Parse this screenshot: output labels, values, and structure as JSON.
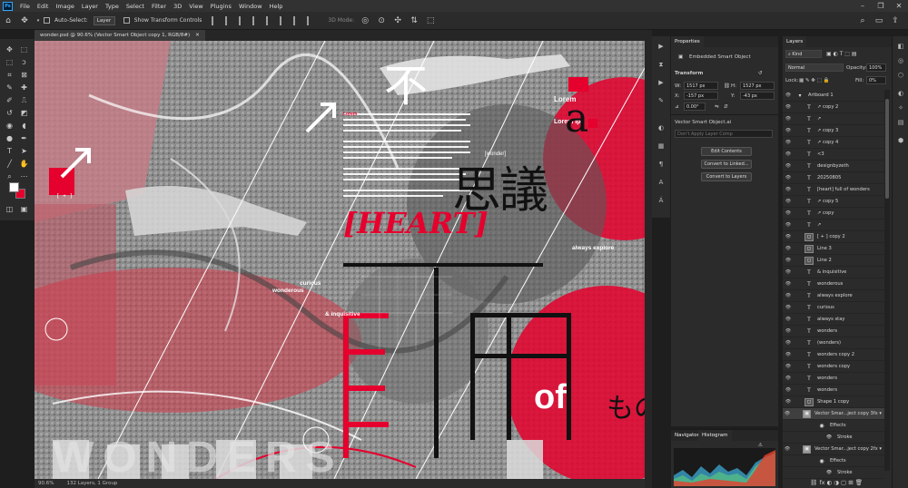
{
  "menu": [
    "File",
    "Edit",
    "Image",
    "Layer",
    "Type",
    "Select",
    "Filter",
    "3D",
    "View",
    "Plugins",
    "Window",
    "Help"
  ],
  "options": {
    "auto_select": "Auto-Select:",
    "layer_select": "Layer",
    "show_transform": "Show Transform Controls",
    "mode_3d": "3D Mode:"
  },
  "document": {
    "tab_title": "wonder.psd @ 90.6% (Vector Smart Object copy 1, RGB/8#)",
    "zoom": "90.6%",
    "layer_count": "132 Layers, 1 Group"
  },
  "canvas_text": {
    "lorem1": "Lorem",
    "lorem2": "Lorem Ip",
    "lorem3": "Lorem",
    "letter_a": "a",
    "kanji1": "思議",
    "heart": "[HEART]",
    "wonder_tag": "[wonder]",
    "always_explore": "always explore",
    "curious": "curious",
    "wonderous": "wonderous",
    "inquisitive": "& inquisitive",
    "of": "of",
    "kanji_bottom": "もの",
    "kanji_top": "不",
    "bottom_word": "WONDERS",
    "canvas_bracket": "[ + ]"
  },
  "properties": {
    "tab": "Properties",
    "kind": "Embedded Smart Object",
    "section": "Transform",
    "w_label": "W:",
    "w": "1517 px",
    "h_label": "H:",
    "h": "1527 px",
    "x_label": "X:",
    "x": "-157 px",
    "y_label": "Y:",
    "y": "-43 px",
    "angle": "0.00°",
    "file": "Vector Smart Object.ai",
    "comp": "Don't Apply Layer Comp",
    "btn_edit": "Edit Contents",
    "btn_linked": "Convert to Linked...",
    "btn_layers": "Convert to Layers"
  },
  "bottom_tabs": {
    "navigator": "Navigator",
    "histogram": "Histogram"
  },
  "layers_panel": {
    "tab": "Layers",
    "kind": "Kind",
    "blend": "Normal",
    "opacity_label": "Opacity:",
    "opacity": "100%",
    "lock_label": "Lock:",
    "fill_label": "Fill:",
    "fill": "0%",
    "rows": [
      {
        "type": "group",
        "name": "Artboard 1"
      },
      {
        "type": "T",
        "name": "↗ copy 2"
      },
      {
        "type": "T",
        "name": "↗"
      },
      {
        "type": "T",
        "name": "↗ copy 3"
      },
      {
        "type": "T",
        "name": "↗ copy 4"
      },
      {
        "type": "T",
        "name": "<3"
      },
      {
        "type": "T",
        "name": "designbyzeth"
      },
      {
        "type": "T",
        "name": "20250805"
      },
      {
        "type": "T",
        "name": "[heart] full of wonders"
      },
      {
        "type": "T",
        "name": "↗ copy 5"
      },
      {
        "type": "T",
        "name": "↗ copy"
      },
      {
        "type": "T",
        "name": "↗"
      },
      {
        "type": "shape",
        "name": "[ + ] copy 2"
      },
      {
        "type": "shape",
        "name": "Line 3"
      },
      {
        "type": "shape",
        "name": "Line 2"
      },
      {
        "type": "T",
        "name": "& inquisitive"
      },
      {
        "type": "T",
        "name": "wonderous"
      },
      {
        "type": "T",
        "name": "always explore"
      },
      {
        "type": "T",
        "name": "curious"
      },
      {
        "type": "T",
        "name": "always stay"
      },
      {
        "type": "T",
        "name": "wonders"
      },
      {
        "type": "T",
        "name": "(wonders)"
      },
      {
        "type": "T",
        "name": "wonders copy 2"
      },
      {
        "type": "T",
        "name": "wonders copy"
      },
      {
        "type": "T",
        "name": "wonders"
      },
      {
        "type": "T",
        "name": "wonders"
      },
      {
        "type": "shape",
        "name": "Shape 1 copy"
      },
      {
        "type": "smart",
        "name": "Vector Smar...ject copy 3",
        "selected": true
      },
      {
        "type": "fx",
        "name": "Effects"
      },
      {
        "type": "fx2",
        "name": "Stroke"
      },
      {
        "type": "smart",
        "name": "Vector Smar...ject copy 2"
      },
      {
        "type": "fx",
        "name": "Effects"
      },
      {
        "type": "fx2",
        "name": "Stroke"
      }
    ]
  },
  "colors": {
    "accent_red": "#e5002d",
    "panel_bg": "#2b2b2b",
    "canvas_gray": "#909090"
  }
}
